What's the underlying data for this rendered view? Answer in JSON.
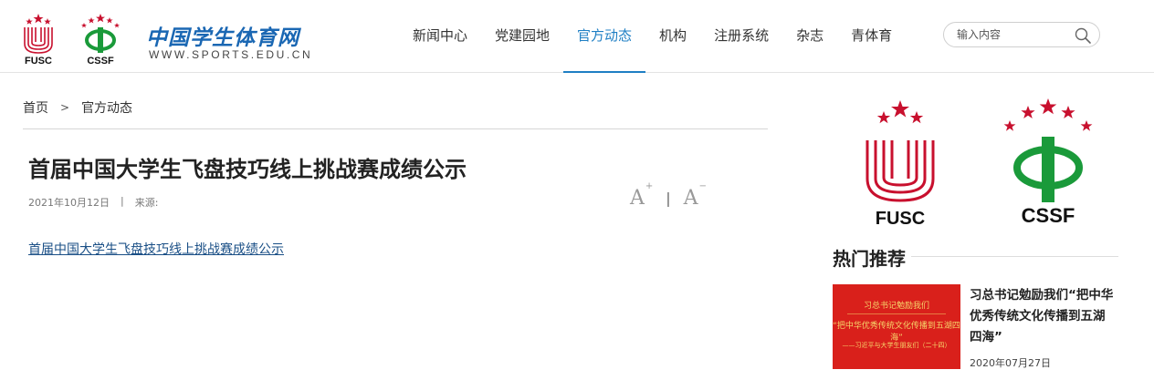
{
  "header": {
    "logos": [
      {
        "label": "FUSC"
      },
      {
        "label": "CSSF"
      }
    ],
    "site_name": "中国学生体育网",
    "site_url": "WWW.SPORTS.EDU.CN",
    "nav": [
      {
        "label": "新闻中心",
        "active": false
      },
      {
        "label": "党建园地",
        "active": false
      },
      {
        "label": "官方动态",
        "active": true
      },
      {
        "label": "机构",
        "active": false
      },
      {
        "label": "注册系统",
        "active": false
      },
      {
        "label": "杂志",
        "active": false
      },
      {
        "label": "青体育",
        "active": false
      }
    ],
    "search": {
      "placeholder": "输入内容",
      "icon": "search-icon"
    }
  },
  "breadcrumb": {
    "home": "首页",
    "separator": ">",
    "current": "官方动态"
  },
  "article": {
    "title": "首届中国大学生飞盘技巧线上挑战赛成绩公示",
    "date": "2021年10月12日",
    "meta_separator": "|",
    "source_label": "来源:",
    "font_controls": {
      "increase": "A",
      "increase_sup": "+",
      "separator": "|",
      "decrease": "A",
      "decrease_sup": "−"
    },
    "attachment_link": "首届中国大学生飞盘技巧线上挑战赛成绩公示"
  },
  "sidebar": {
    "logos": [
      {
        "label": "FUSC"
      },
      {
        "label": "CSSF"
      }
    ],
    "hot_title": "热门推荐",
    "hot_items": [
      {
        "thumb_lines": [
          "习总书记勉励我们",
          "“把中华优秀传统文化传播到五湖四海”",
          "——习近平与大学生朋友们（二十四）"
        ],
        "title": "习总书记勉励我们“把中华优秀传统文化传播到五湖四海”",
        "date": "2020年07月27日"
      }
    ]
  },
  "colors": {
    "brand_blue": "#1a67b3",
    "nav_active": "#1f7fc4",
    "logo_red": "#c8102e",
    "logo_green": "#1a9a3a",
    "thumb_red": "#d9201b"
  }
}
